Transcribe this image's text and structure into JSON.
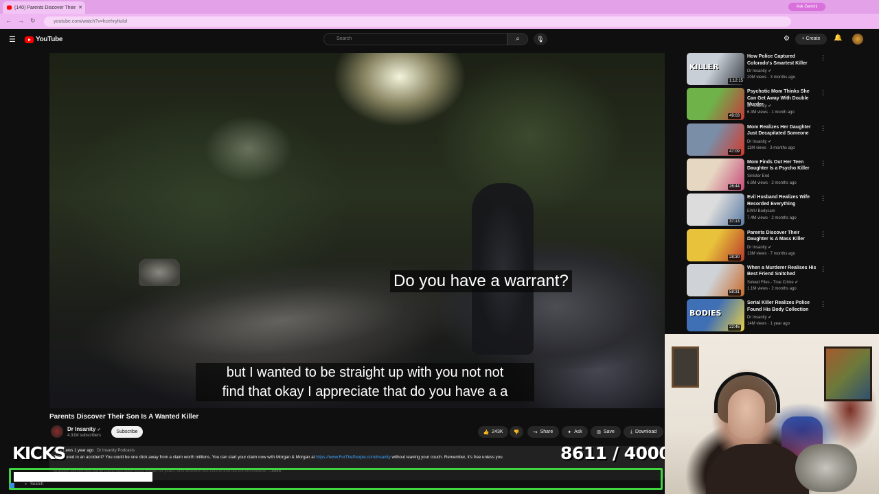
{
  "browser": {
    "tab_title": "(140) Parents Discover Their",
    "url": "youtube.com/watch?v=hcehryltulol",
    "gemini_label": "Ask Gemini"
  },
  "header": {
    "logo_text": "YouTube",
    "search_placeholder": "Search",
    "create_label": "Create"
  },
  "video": {
    "subtitle_top": "Do you have a warrant?",
    "subtitle_bottom_line1": "but I wanted to be straight up with you not not",
    "subtitle_bottom_line2": "find that okay I appreciate that do you have a a",
    "title": "Parents Discover Their Son Is A Wanted Killer"
  },
  "channel": {
    "name": "Dr Insanity",
    "subscribers": "4.31M subscribers",
    "subscribe_label": "Subscribe"
  },
  "actions": {
    "likes": "243K",
    "share": "Share",
    "ask": "Ask",
    "save": "Save",
    "download": "Download"
  },
  "description": {
    "views": "12M views",
    "age": "1 year ago",
    "tag": "Dr Insanity Podcasts",
    "text_before_link": "Got injured in an accident? You could be one click away from a claim worth millions. You can start your claim now with Morgan & Morgan at",
    "link": "https://www.ForThePeople.com/insanity",
    "text_after_link": "without leaving your couch. Remember, it's free unless you",
    "line2": "Brandon Dorsey and Aaron Davis had been close friends for years, until Brandon lost control and did the unthinkable.",
    "more": "...more"
  },
  "overlay": {
    "kicks_label": "KICKS",
    "counter_current": "8611",
    "counter_sep": "/",
    "counter_goal": "40000",
    "progress_fraction": 0.2153,
    "taskbar_search": "Search"
  },
  "sidebar": {
    "items": [
      {
        "title": "How Police Captured Colorado's Smartest Killer",
        "channel": "Dr Insanity",
        "verified": true,
        "views": "20M views · 3 months ago",
        "duration": "1:12:15",
        "colors": [
          "#c9cfd6",
          "#3a3f47"
        ],
        "thumb_text": "KILLER"
      },
      {
        "title": "Psychotic Mom Thinks She Can Get Away With Double Murder",
        "channel": "Dr Insanity",
        "verified": true,
        "views": "6.3M views · 1 month ago",
        "duration": "49:03",
        "colors": [
          "#6fb24a",
          "#c23b3b"
        ],
        "thumb_text": ""
      },
      {
        "title": "Mom Realizes Her Daughter Just Decapitated Someone",
        "channel": "Dr Insanity",
        "verified": true,
        "views": "11M views · 3 months ago",
        "duration": "47:09",
        "colors": [
          "#7a8ea8",
          "#d23a2a"
        ],
        "thumb_text": ""
      },
      {
        "title": "Mom Finds Out Her Teen Daughter Is a Psycho Killer",
        "channel": "Sinister End",
        "verified": false,
        "views": "6.6M views · 2 months ago",
        "duration": "26:44",
        "colors": [
          "#e6d7c2",
          "#c74b7a"
        ],
        "thumb_text": ""
      },
      {
        "title": "Evil Husband Realizes Wife Recorded Everything",
        "channel": "EWU Bodycam",
        "verified": false,
        "views": "7.4M views · 2 months ago",
        "duration": "37:13",
        "colors": [
          "#dcdcdc",
          "#5a7aa3"
        ],
        "thumb_text": ""
      },
      {
        "title": "Parents Discover Their Daughter Is A Mass Killer",
        "channel": "Dr Insanity",
        "verified": true,
        "views": "13M views · 7 months ago",
        "duration": "28:30",
        "colors": [
          "#e8c23a",
          "#b83a2a"
        ],
        "thumb_text": ""
      },
      {
        "title": "When a Murderer Realises His Best Friend Snitched",
        "channel": "Solved Files - True Crime",
        "verified": true,
        "views": "1.1M views · 2 months ago",
        "duration": "58:31",
        "colors": [
          "#cfd3d8",
          "#c86a2a"
        ],
        "thumb_text": ""
      },
      {
        "title": "Serial Killer Realizes Police Found His Body Collection",
        "channel": "Dr Insanity",
        "verified": true,
        "views": "14M views · 1 year ago",
        "duration": "22:46",
        "colors": [
          "#3f6fb4",
          "#e8d04a"
        ],
        "thumb_text": "BODIES"
      }
    ]
  }
}
